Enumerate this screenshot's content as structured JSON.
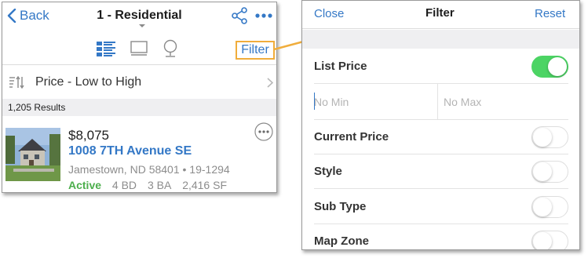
{
  "colors": {
    "accent": "#3478c6",
    "highlight": "#f0ad3c",
    "active_green": "#4cae4c",
    "toggle_on": "#4cd464"
  },
  "left_screen": {
    "header": {
      "back_label": "Back",
      "title": "1 - Residential",
      "icons": [
        "chevron-left-icon",
        "share-icon",
        "more-horizontal-icon"
      ]
    },
    "view_bar": {
      "icons": [
        "list-view-icon",
        "gallery-view-icon",
        "map-view-icon"
      ],
      "filter_label": "Filter"
    },
    "sort": {
      "label": "Price - Low to High",
      "icon": "sort-icon"
    },
    "results": {
      "count_label": "1,205 Results"
    },
    "listing": {
      "price": "$8,075",
      "address": "1008 7TH Avenue SE",
      "city_line": "Jamestown, ND 58401 • 19-1294",
      "status": "Active",
      "beds": "4 BD",
      "baths": "3 BA",
      "sqft": "2,416 SF"
    }
  },
  "right_screen": {
    "header": {
      "close_label": "Close",
      "title": "Filter",
      "reset_label": "Reset"
    },
    "list_price": {
      "label": "List Price",
      "enabled": true,
      "min_placeholder": "No Min",
      "max_placeholder": "No Max"
    },
    "filters": [
      {
        "label": "Current Price",
        "enabled": false
      },
      {
        "label": "Style",
        "enabled": false
      },
      {
        "label": "Sub Type",
        "enabled": false
      },
      {
        "label": "Map Zone",
        "enabled": false
      }
    ]
  }
}
